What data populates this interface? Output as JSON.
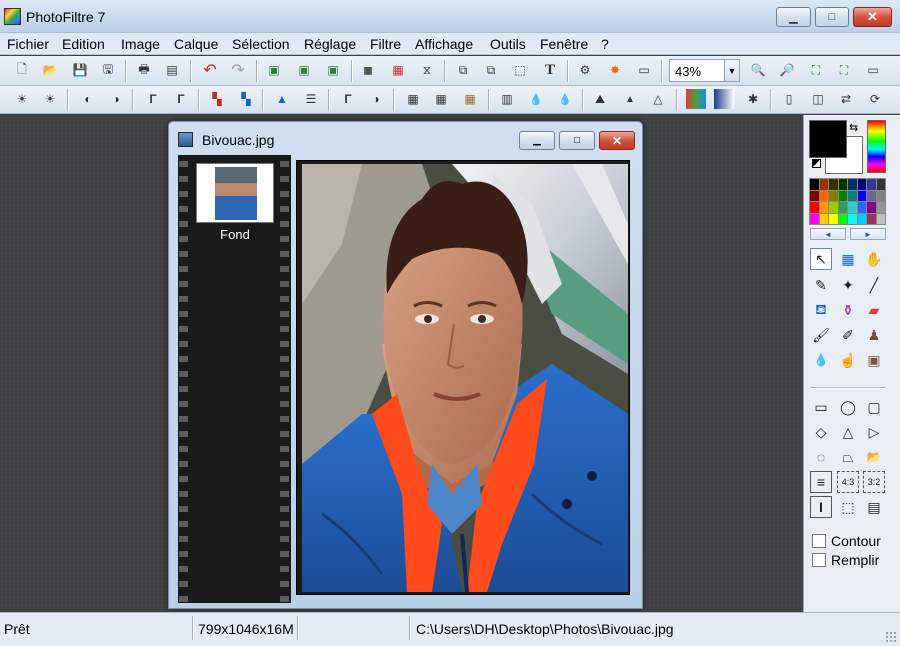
{
  "window": {
    "title": "PhotoFiltre 7",
    "minimize_symbol": "▁",
    "maximize_symbol": "□",
    "close_symbol": "✕"
  },
  "menu": [
    {
      "label": "Fichier"
    },
    {
      "label": "Edition"
    },
    {
      "label": "Image"
    },
    {
      "label": "Calque"
    },
    {
      "label": "Sélection"
    },
    {
      "label": "Réglage"
    },
    {
      "label": "Filtre"
    },
    {
      "label": "Affichage"
    },
    {
      "label": "Outils"
    },
    {
      "label": "Fenêtre"
    },
    {
      "label": "?"
    }
  ],
  "toolbar1": {
    "buttons": [
      {
        "name": "new-file-icon",
        "glyph": "🗋"
      },
      {
        "name": "open-folder-icon",
        "glyph": "📂"
      },
      {
        "name": "save-icon",
        "glyph": "💾"
      },
      {
        "name": "save-as-icon",
        "glyph": "🖫"
      },
      {
        "name": "print-icon",
        "glyph": "🖶"
      },
      {
        "name": "scan-icon",
        "glyph": "▤"
      },
      {
        "name": "undo-icon",
        "glyph": "↶"
      },
      {
        "name": "redo-icon",
        "glyph": "↷"
      },
      {
        "name": "image-size-icon",
        "glyph": "▣"
      },
      {
        "name": "canvas-size-icon",
        "glyph": "▣"
      },
      {
        "name": "crop-icon",
        "glyph": "▣"
      },
      {
        "name": "gradient-icon",
        "glyph": "◼"
      },
      {
        "name": "color-grid-icon",
        "glyph": "▦"
      },
      {
        "name": "transform-icon",
        "glyph": "⧖"
      },
      {
        "name": "layer-copy-icon",
        "glyph": "⧉"
      },
      {
        "name": "layer-paste-icon",
        "glyph": "⧉"
      },
      {
        "name": "selection-icon",
        "glyph": "⬚"
      },
      {
        "name": "text-icon",
        "glyph": "T"
      },
      {
        "name": "plugins-icon",
        "glyph": "⚙"
      },
      {
        "name": "effects-icon",
        "glyph": "✸"
      },
      {
        "name": "browser-icon",
        "glyph": "▭"
      }
    ],
    "zoom_value": "43%",
    "zoom_dropdown_symbol": "▼",
    "right_buttons": [
      {
        "name": "zoom-in-icon",
        "glyph": "🔍"
      },
      {
        "name": "zoom-out-icon",
        "glyph": "🔎"
      },
      {
        "name": "fit-image-icon",
        "glyph": "⛶"
      },
      {
        "name": "actual-size-icon",
        "glyph": "⛶"
      },
      {
        "name": "fullscreen-icon",
        "glyph": "▭"
      }
    ]
  },
  "toolbar2": {
    "buttons": [
      {
        "name": "brightness-minus-icon",
        "glyph": "☀"
      },
      {
        "name": "brightness-plus-icon",
        "glyph": "☀"
      },
      {
        "name": "contrast-minus-icon",
        "glyph": "◐"
      },
      {
        "name": "contrast-plus-icon",
        "glyph": "◑"
      },
      {
        "name": "gamma-minus-icon",
        "glyph": "Γ"
      },
      {
        "name": "gamma-plus-icon",
        "glyph": "Γ"
      },
      {
        "name": "saturation-minus-icon",
        "glyph": "▚"
      },
      {
        "name": "saturation-plus-icon",
        "glyph": "▚"
      },
      {
        "name": "histogram-icon",
        "glyph": "▲"
      },
      {
        "name": "levels-icon",
        "glyph": "☰"
      },
      {
        "name": "auto-levels-icon",
        "glyph": "Γ"
      },
      {
        "name": "auto-contrast-icon",
        "glyph": "◑"
      },
      {
        "name": "filter-grid-1-icon",
        "glyph": "▦"
      },
      {
        "name": "filter-grid-2-icon",
        "glyph": "▦"
      },
      {
        "name": "filter-grid-3-icon",
        "glyph": "▦"
      },
      {
        "name": "sharpen-icon",
        "glyph": "▥"
      },
      {
        "name": "drop-icon",
        "glyph": "💧"
      },
      {
        "name": "drop-plus-icon",
        "glyph": "💧"
      },
      {
        "name": "emboss-icon",
        "glyph": "⛰"
      },
      {
        "name": "triangle-icon",
        "glyph": "▲"
      },
      {
        "name": "triangle-outline-icon",
        "glyph": "△"
      },
      {
        "name": "rgb-icon",
        "glyph": "▮"
      },
      {
        "name": "gradient-fill-icon",
        "glyph": "▮"
      },
      {
        "name": "special-effect-icon",
        "glyph": "✱"
      },
      {
        "name": "texture-icon",
        "glyph": "▯"
      },
      {
        "name": "frame-icon",
        "glyph": "◫"
      },
      {
        "name": "flip-icon",
        "glyph": "⇄"
      },
      {
        "name": "rotate-icon",
        "glyph": "⟳"
      }
    ]
  },
  "document": {
    "title": "Bivouac.jpg",
    "minimize_symbol": "▁",
    "maximize_symbol": "□",
    "close_symbol": "✕",
    "layer_label": "Fond"
  },
  "tools": [
    {
      "name": "pointer-tool-icon",
      "glyph": "↖",
      "selected": true
    },
    {
      "name": "image-tool-icon",
      "glyph": "▦"
    },
    {
      "name": "hand-tool-icon",
      "glyph": "✋"
    },
    {
      "name": "eyedropper-icon",
      "glyph": "✎"
    },
    {
      "name": "magic-wand-icon",
      "glyph": "✦"
    },
    {
      "name": "line-tool-icon",
      "glyph": "╱"
    },
    {
      "name": "paint-bucket-icon",
      "glyph": "⛾"
    },
    {
      "name": "spray-icon",
      "glyph": "⚱"
    },
    {
      "name": "eraser-icon",
      "glyph": "▰"
    },
    {
      "name": "brush-icon",
      "glyph": "🖌"
    },
    {
      "name": "advanced-brush-icon",
      "glyph": "✐"
    },
    {
      "name": "stamp-icon",
      "glyph": "♟"
    },
    {
      "name": "blur-drop-icon",
      "glyph": "💧"
    },
    {
      "name": "smudge-icon",
      "glyph": "☝"
    },
    {
      "name": "clone-icon",
      "glyph": "▣"
    }
  ],
  "shape_tools": [
    {
      "name": "rectangle-shape-icon",
      "glyph": "▭"
    },
    {
      "name": "ellipse-shape-icon",
      "glyph": "◯"
    },
    {
      "name": "rounded-rect-shape-icon",
      "glyph": "▢"
    },
    {
      "name": "diamond-shape-icon",
      "glyph": "◇"
    },
    {
      "name": "triangle-shape-icon",
      "glyph": "△"
    },
    {
      "name": "arrow-shape-icon",
      "glyph": "▷"
    },
    {
      "name": "lasso-icon",
      "glyph": "◌"
    },
    {
      "name": "polygon-lasso-icon",
      "glyph": "⏢"
    },
    {
      "name": "open-shape-icon",
      "glyph": "📂"
    },
    {
      "name": "align-center-icon",
      "glyph": "≡"
    },
    {
      "name": "ratio-43-icon",
      "glyph": "4:3"
    },
    {
      "name": "ratio-32-icon",
      "glyph": "3:2"
    },
    {
      "name": "text-cursor-icon",
      "glyph": "I"
    },
    {
      "name": "dashed-selection-icon",
      "glyph": "⬚"
    },
    {
      "name": "window-icon",
      "glyph": "▤"
    }
  ],
  "options": {
    "outline_label": "Contour",
    "fill_label": "Remplir"
  },
  "palette": {
    "colors": [
      "#000000",
      "#993300",
      "#333300",
      "#003300",
      "#003366",
      "#000080",
      "#333399",
      "#333333",
      "#800000",
      "#ff6600",
      "#808000",
      "#008000",
      "#008080",
      "#0000ff",
      "#666699",
      "#808080",
      "#ff0000",
      "#ff9900",
      "#99cc00",
      "#339966",
      "#33cccc",
      "#3366ff",
      "#800080",
      "#969696",
      "#ff00ff",
      "#ffcc00",
      "#ffff00",
      "#00ff00",
      "#00ffff",
      "#00ccff",
      "#993366",
      "#c0c0c0"
    ],
    "prev_symbol": "◄",
    "next_symbol": "►",
    "swap_symbol": "⇆"
  },
  "status": {
    "state": "Prêt",
    "dimensions": "799x1046x16M",
    "path": "C:\\Users\\DH\\Desktop\\Photos\\Bivouac.jpg"
  }
}
